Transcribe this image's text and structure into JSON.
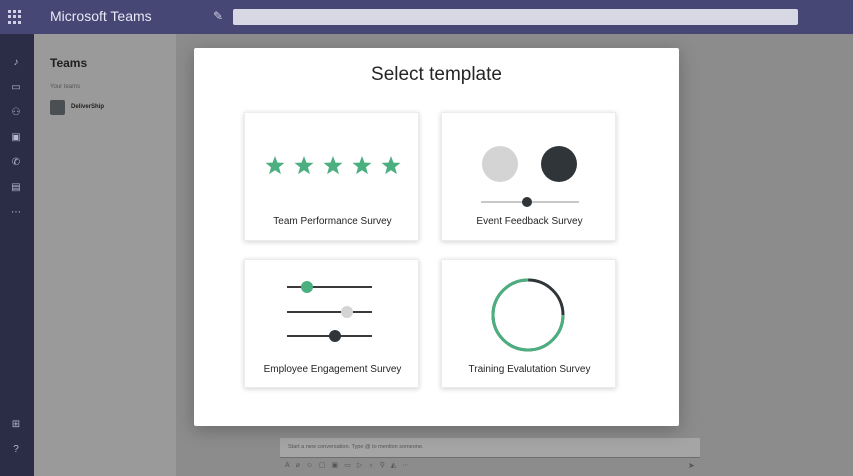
{
  "app": {
    "title": "Microsoft Teams",
    "accent_color": "#464775"
  },
  "topbar": {
    "compose_icon": "compose-icon",
    "waffle_icon": "app-launcher-icon"
  },
  "rail": {
    "icons": [
      "bell-icon",
      "chat-icon",
      "teams-icon",
      "calendar-icon",
      "calls-icon",
      "files-icon",
      "more-icon",
      "apps-icon",
      "help-icon"
    ]
  },
  "teams_panel": {
    "title": "Teams",
    "section": "Your teams",
    "teams": [
      {
        "name": "DeliverShip"
      }
    ]
  },
  "compose": {
    "placeholder": "Start a new conversation. Type @ to mention someone."
  },
  "modal": {
    "title": "Select template",
    "accent_color": "#4caf7f",
    "templates": [
      {
        "label": "Team Performance Survey",
        "icon": "stars-rating-icon",
        "stars": 5
      },
      {
        "label": "Event Feedback Survey",
        "icon": "slider-choice-icon"
      },
      {
        "label": "Employee Engagement Survey",
        "icon": "multi-slider-icon"
      },
      {
        "label": "Training Evalutation Survey",
        "icon": "progress-ring-icon",
        "progress": 0.75
      }
    ]
  }
}
